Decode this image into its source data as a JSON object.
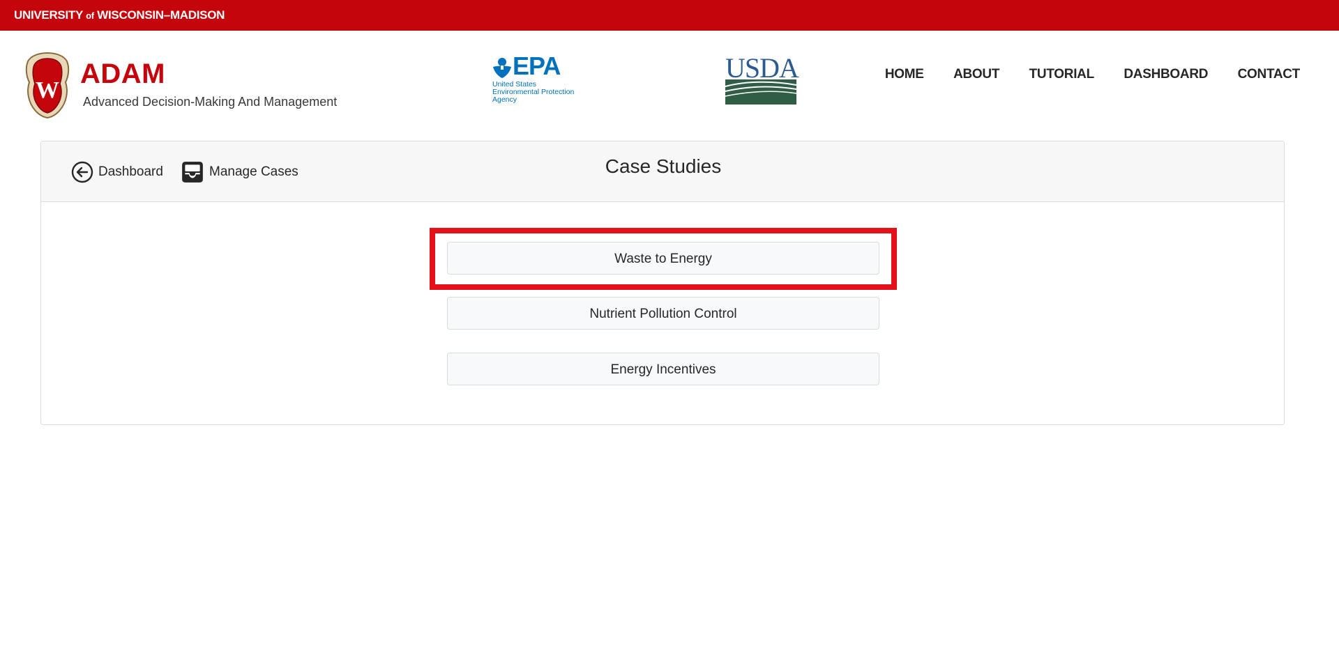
{
  "topbar": {
    "uw_prefix": "UNIVERSITY",
    "uw_of": "of",
    "uw_suffix": "WISCONSIN–MADISON"
  },
  "brand": {
    "crest_icon": "uw-crest-icon",
    "name": "ADAM",
    "subtitle": "Advanced Decision-Making And Management"
  },
  "partners": {
    "epa": {
      "word": "EPA",
      "line1": "United States",
      "line2": "Environmental Protection",
      "line3": "Agency"
    },
    "usda": {
      "word": "USDA"
    }
  },
  "nav": {
    "items": [
      {
        "label": "HOME"
      },
      {
        "label": "ABOUT"
      },
      {
        "label": "TUTORIAL"
      },
      {
        "label": "DASHBOARD"
      },
      {
        "label": "CONTACT"
      }
    ]
  },
  "card": {
    "back_label": "Dashboard",
    "back_icon": "arrow-left-circle-icon",
    "manage_label": "Manage Cases",
    "manage_icon": "inbox-icon",
    "title": "Case Studies",
    "cases": [
      {
        "label": "Waste to Energy",
        "highlighted": true
      },
      {
        "label": "Nutrient Pollution Control",
        "highlighted": false
      },
      {
        "label": "Energy Incentives",
        "highlighted": false
      }
    ]
  },
  "colors": {
    "brand_red": "#c5050c",
    "highlight_red": "#e4111a",
    "epa_blue": "#0071bc",
    "usda_blue": "#2b5b93",
    "usda_green": "#2f5d45"
  }
}
